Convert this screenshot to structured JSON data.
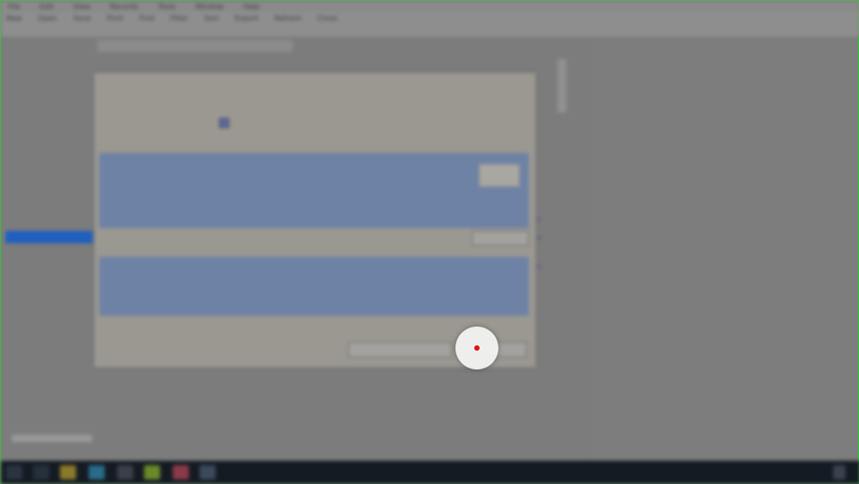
{
  "menubar": [
    "File",
    "Edit",
    "View",
    "Records",
    "Tools",
    "Window",
    "Help"
  ],
  "toolbar": [
    "New",
    "Open",
    "Save",
    "Print",
    "Find",
    "Filter",
    "Sort",
    "Export",
    "Refresh",
    "Close"
  ],
  "background_window": {
    "title": "",
    "title_right": "",
    "side_items": [
      "",
      "",
      "",
      "",
      "",
      "",
      "",
      "",
      ""
    ],
    "bottom_status": ""
  },
  "dialog": {
    "title": "",
    "caption": "",
    "option_rows": [
      {
        "label": "",
        "value": ""
      },
      {
        "label": "",
        "value": ""
      }
    ],
    "info_heading": "",
    "info_lines": [
      "",
      "",
      ""
    ],
    "section1_label": "",
    "grid1": {
      "headers": [
        "",
        "",
        "",
        "",
        "",
        "",
        "",
        "",
        ""
      ],
      "rows": [
        [
          "",
          "",
          "",
          "",
          ""
        ],
        [
          "",
          "",
          "",
          "",
          ""
        ]
      ]
    },
    "middle_button": "",
    "section2_label": "",
    "grid2": {
      "headers": [
        "",
        "",
        "",
        "",
        "",
        "",
        "",
        "",
        ""
      ]
    },
    "bottom_left_button": "",
    "ok_button": "",
    "footnote": ""
  },
  "right_panel": {
    "items": [
      "",
      "",
      "",
      "",
      "",
      ""
    ]
  },
  "taskbar": {
    "clock": ""
  },
  "colors": {
    "accent_blue": "#1f5fbf",
    "grid_fill": "#6d82a5",
    "label_purple": "#9a2a8a",
    "frame_green": "#32c832",
    "cursor_red": "#e01010"
  }
}
